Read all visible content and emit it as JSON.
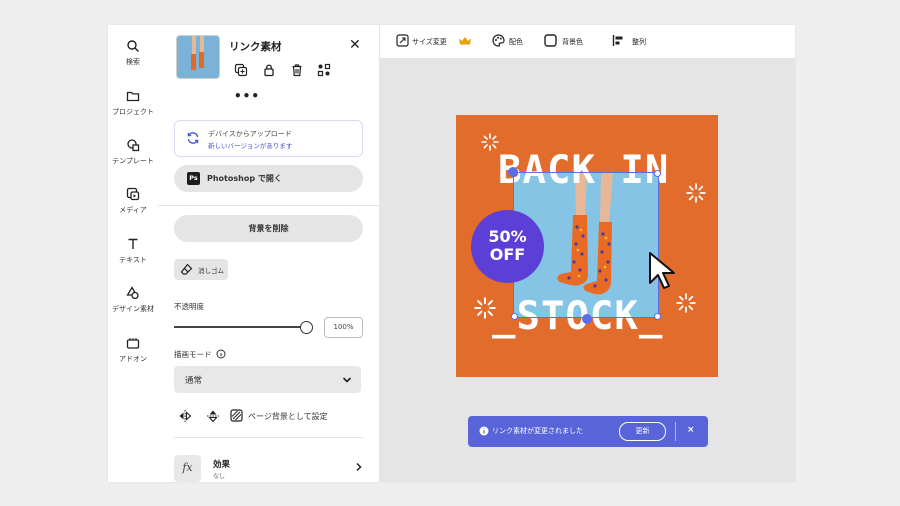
{
  "rail": [
    {
      "label": "検索",
      "icon": "search-icon"
    },
    {
      "label": "プロジェクト",
      "icon": "folder-icon"
    },
    {
      "label": "テンプレート",
      "icon": "template-icon"
    },
    {
      "label": "メディア",
      "icon": "media-icon"
    },
    {
      "label": "テキスト",
      "icon": "text-icon"
    },
    {
      "label": "デザイン素材",
      "icon": "shapes-icon"
    },
    {
      "label": "アドオン",
      "icon": "addon-icon"
    }
  ],
  "panel": {
    "title": "リンク素材",
    "more": "•••",
    "upload": {
      "title": "デバイスからアップロード",
      "subtitle": "新しいバージョンがあります"
    },
    "photoshop_label": "Photoshop で開く",
    "ps_badge": "Ps",
    "remove_bg_label": "背景を削除",
    "eraser_label": "消しゴム",
    "opacity_label": "不透明度",
    "opacity_value": "100%",
    "opacity": 1.0,
    "blend_label": "描画モード",
    "blend_value": "通常",
    "set_bg_label": "ページ背景として設定",
    "effects": {
      "title": "効果",
      "subtitle": "なし",
      "icon": "fx"
    }
  },
  "topbar": {
    "resize": "サイズ変更",
    "color": "配色",
    "bg_color": "背景色",
    "align": "整列"
  },
  "design": {
    "line1": "BACK IN",
    "line2": "_STOCK_",
    "badge_top": "50%",
    "badge_bottom": "OFF",
    "colors": {
      "background": "#e26c2b",
      "photo": "#86c4e6",
      "badge": "#5b3fd6"
    }
  },
  "toast": {
    "message": "リンク素材が変更されました",
    "action": "更新",
    "close": "×"
  },
  "accent": "#5864d8"
}
